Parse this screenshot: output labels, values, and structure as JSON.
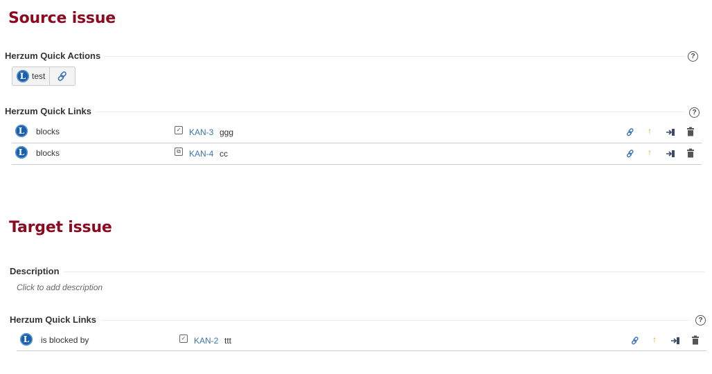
{
  "source": {
    "heading": "Source issue",
    "quick_actions": {
      "title": "Herzum Quick Actions",
      "help": "?",
      "buttons": [
        {
          "icon": "L",
          "label": "test"
        },
        {
          "icon": "link-icon",
          "label": ""
        }
      ]
    },
    "quick_links": {
      "title": "Herzum Quick Links",
      "help": "?",
      "rows": [
        {
          "icon": "L",
          "relation": "blocks",
          "type_icon": "task-icon",
          "key": "KAN-3",
          "summary": "ggg"
        },
        {
          "icon": "L",
          "relation": "blocks",
          "type_icon": "subtask-icon",
          "key": "KAN-4",
          "summary": "cc"
        }
      ]
    }
  },
  "target": {
    "heading": "Target issue",
    "description": {
      "title": "Description",
      "placeholder": "Click to add description"
    },
    "quick_links": {
      "title": "Herzum Quick Links",
      "help": "?",
      "rows": [
        {
          "icon": "L",
          "relation": "is blocked by",
          "type_icon": "task-icon",
          "key": "KAN-2",
          "summary": "ttt"
        }
      ]
    }
  },
  "row_actions": [
    "link-icon",
    "priority-arrow-icon",
    "move-icon",
    "trash-icon"
  ],
  "colors": {
    "heading": "#8b0a1f",
    "issue_key": "#3b73af",
    "priority": "#f0a000",
    "action_icon": "#3b73af"
  }
}
